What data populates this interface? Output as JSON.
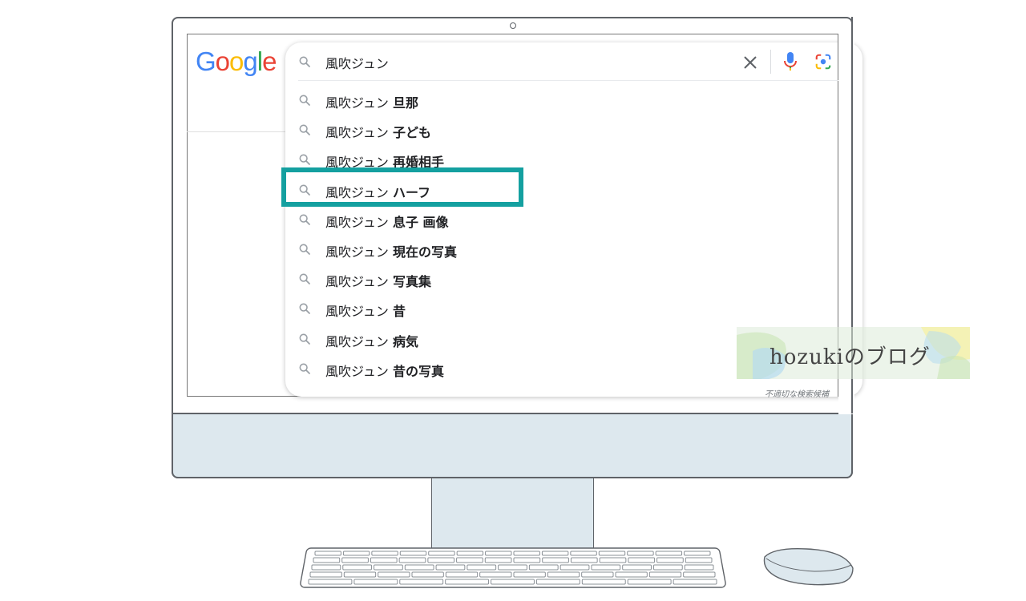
{
  "search": {
    "logo_letters": [
      {
        "ch": "G",
        "color": "#4285F4"
      },
      {
        "ch": "o",
        "color": "#EA4335"
      },
      {
        "ch": "o",
        "color": "#FBBC05"
      },
      {
        "ch": "g",
        "color": "#4285F4"
      },
      {
        "ch": "l",
        "color": "#34A853"
      },
      {
        "ch": "e",
        "color": "#EA4335"
      }
    ],
    "query": "風吹ジュン",
    "suggestions": [
      {
        "prefix": "風吹ジュン ",
        "bold": "旦那"
      },
      {
        "prefix": "風吹ジュン ",
        "bold": "子ども"
      },
      {
        "prefix": "風吹ジュン ",
        "bold": "再婚相手"
      },
      {
        "prefix": "風吹ジュン ",
        "bold": "ハーフ"
      },
      {
        "prefix": "風吹ジュン ",
        "bold": "息子 画像"
      },
      {
        "prefix": "風吹ジュン ",
        "bold": "現在の写真"
      },
      {
        "prefix": "風吹ジュン ",
        "bold": "写真集"
      },
      {
        "prefix": "風吹ジュン ",
        "bold": "昔"
      },
      {
        "prefix": "風吹ジュン ",
        "bold": "病気"
      },
      {
        "prefix": "風吹ジュン ",
        "bold": "昔の写真"
      }
    ],
    "footnote": "不適切な検索候補",
    "highlight_color": "#14a0a0"
  },
  "icons": {
    "search": "search-icon",
    "clear": "close-icon",
    "voice": "mic-icon",
    "lens": "google-lens-icon"
  },
  "watermark": {
    "text": "hozukiのブログ"
  }
}
